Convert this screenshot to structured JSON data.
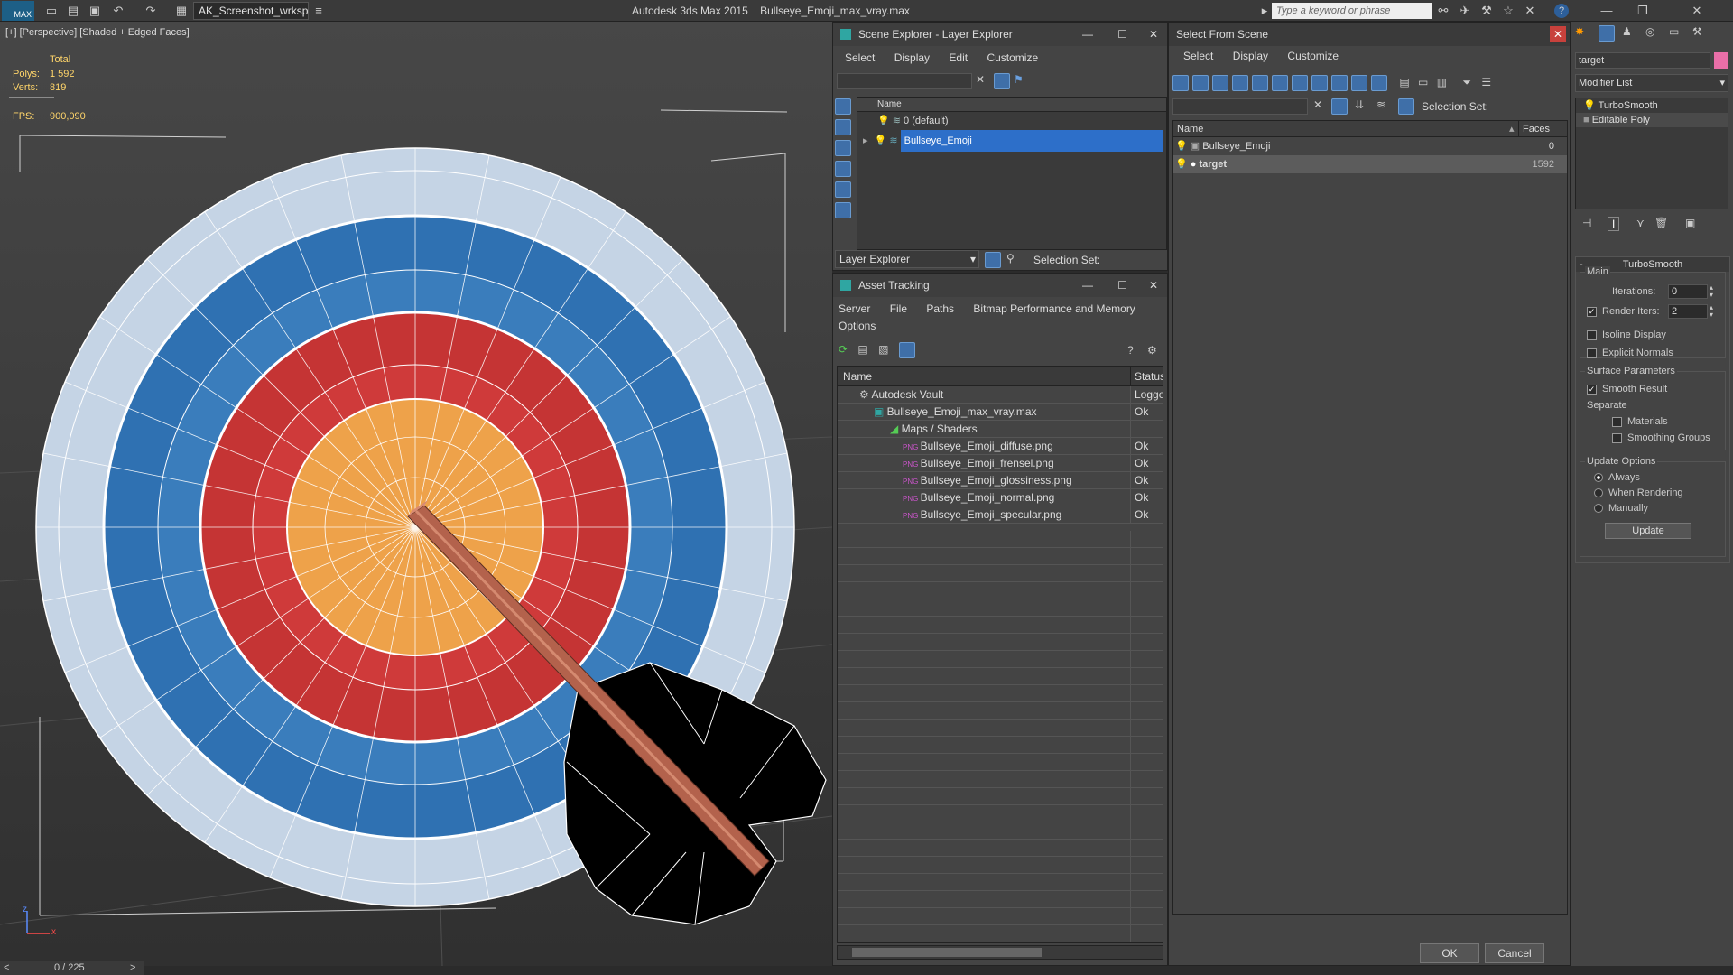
{
  "titlebar": {
    "logo": "MAX",
    "workspace": "AK_Screenshot_wrksp",
    "app_title": "Autodesk 3ds Max  2015",
    "file_title": "Bullseye_Emoji_max_vray.max",
    "search_placeholder": "Type a keyword or phrase"
  },
  "viewport": {
    "label": "[+] [Perspective] [Shaded + Edged Faces]",
    "stats_total": "Total",
    "polys_label": "Polys:",
    "polys_value": "1 592",
    "verts_label": "Verts:",
    "verts_value": "819",
    "fps_label": "FPS:",
    "fps_value": "900,090",
    "axis_z": "z",
    "axis_x": "x"
  },
  "timeline": {
    "frame": "0 / 225",
    "prev": "<",
    "next": ">"
  },
  "scene_explorer": {
    "title": "Scene Explorer - Layer Explorer",
    "menu": [
      "Select",
      "Display",
      "Edit",
      "Customize"
    ],
    "col_name": "Name",
    "rows": [
      {
        "label": "0 (default)"
      },
      {
        "label": "Bullseye_Emoji"
      }
    ],
    "footer_label": "Layer Explorer",
    "selection_set": "Selection Set:"
  },
  "asset_tracking": {
    "title": "Asset Tracking",
    "menu": [
      "Server",
      "File",
      "Paths",
      "Bitmap Performance and Memory",
      "Options"
    ],
    "col_name": "Name",
    "col_status": "Status",
    "rows": [
      {
        "name": "Autodesk Vault",
        "status": "Logged"
      },
      {
        "name": "Bullseye_Emoji_max_vray.max",
        "status": "Ok"
      },
      {
        "name": "Maps / Shaders",
        "status": ""
      },
      {
        "name": "Bullseye_Emoji_diffuse.png",
        "status": "Ok"
      },
      {
        "name": "Bullseye_Emoji_frensel.png",
        "status": "Ok"
      },
      {
        "name": "Bullseye_Emoji_glossiness.png",
        "status": "Ok"
      },
      {
        "name": "Bullseye_Emoji_normal.png",
        "status": "Ok"
      },
      {
        "name": "Bullseye_Emoji_specular.png",
        "status": "Ok"
      }
    ]
  },
  "select_from_scene": {
    "title": "Select From Scene",
    "menu": [
      "Select",
      "Display",
      "Customize"
    ],
    "selection_set": "Selection Set:",
    "col_name": "Name",
    "col_faces": "Faces",
    "rows": [
      {
        "name": "Bullseye_Emoji",
        "faces": "0"
      },
      {
        "name": "target",
        "faces": "1592"
      }
    ],
    "ok": "OK",
    "cancel": "Cancel"
  },
  "modifier_panel": {
    "object_name": "target",
    "modifier_list": "Modifier List",
    "stack": [
      "TurboSmooth",
      "Editable Poly"
    ],
    "rollout_title": "TurboSmooth",
    "main": "Main",
    "iterations_label": "Iterations:",
    "iterations_value": "0",
    "render_iters_label": "Render Iters:",
    "render_iters_value": "2",
    "isoline": "Isoline Display",
    "explicit_normals": "Explicit Normals",
    "surface_params": "Surface Parameters",
    "smooth_result": "Smooth Result",
    "separate": "Separate",
    "materials": "Materials",
    "smoothing_groups": "Smoothing Groups",
    "update_options": "Update Options",
    "always": "Always",
    "when_rendering": "When Rendering",
    "manually": "Manually",
    "update_btn": "Update"
  },
  "colors": {
    "accent": "#3d6fb5",
    "target_red": "#d23b3b",
    "target_blue": "#3f7fc0",
    "target_orange": "#f2a444",
    "target_white": "#c9d6e6"
  }
}
